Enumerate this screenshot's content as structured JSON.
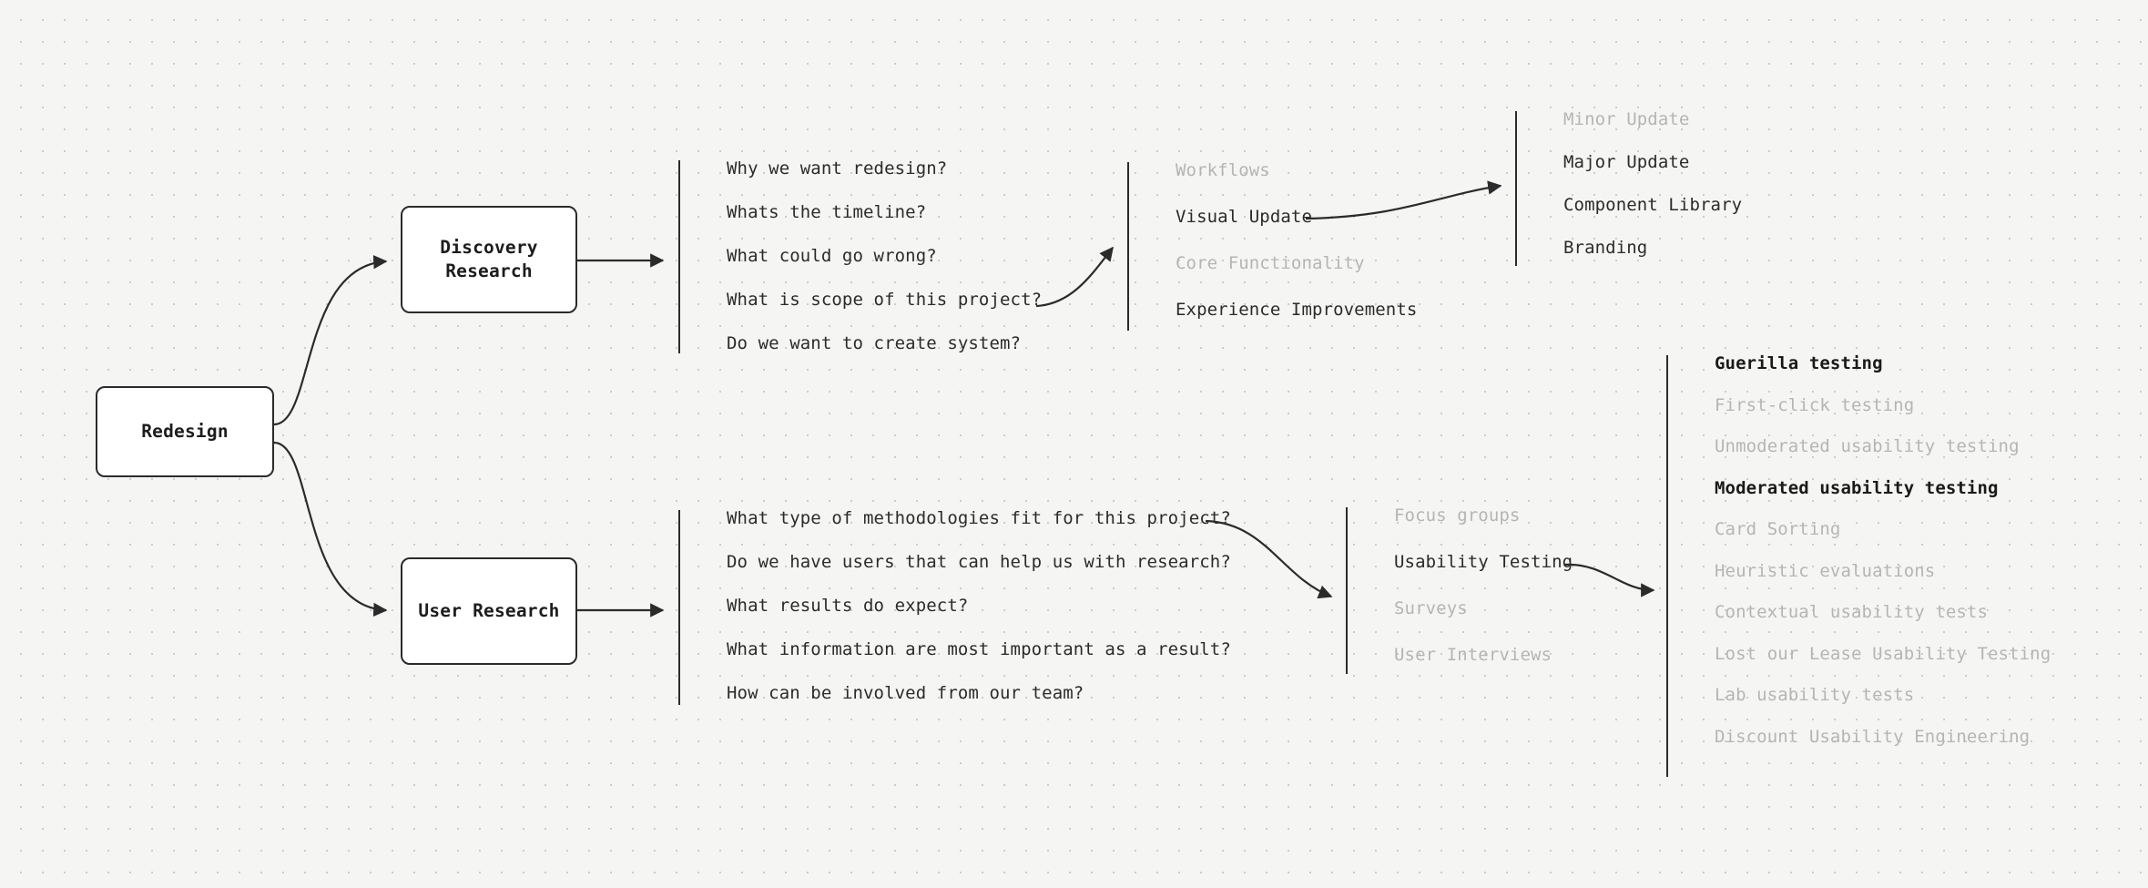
{
  "diagram": {
    "title": "Redesign research map",
    "background_color": "#f5f5f4",
    "grid_dot_color": "#cccccc",
    "line_color": "#2b2b2b",
    "muted_text_color": "#b5b5b5"
  },
  "nodes": {
    "root": {
      "label": "Redesign"
    },
    "discovery": {
      "label": "Discovery\nResearch"
    },
    "user": {
      "label": "User Research"
    }
  },
  "columns": {
    "discovery_questions": {
      "name": "discovery-questions",
      "items": [
        {
          "label": "Why we want redesign?",
          "state": "active"
        },
        {
          "label": "Whats the timeline?",
          "state": "active"
        },
        {
          "label": "What could go wrong?",
          "state": "active"
        },
        {
          "label": "What is scope of this project?",
          "state": "active"
        },
        {
          "label": "Do we want to create system?",
          "state": "active"
        }
      ]
    },
    "update_types": {
      "name": "update-types",
      "items": [
        {
          "label": "Workflows",
          "state": "muted"
        },
        {
          "label": "Visual Update",
          "state": "active"
        },
        {
          "label": "Core Functionality",
          "state": "muted"
        },
        {
          "label": "Experience Improvements",
          "state": "active"
        }
      ]
    },
    "update_scope": {
      "name": "update-scope",
      "items": [
        {
          "label": "Minor Update",
          "state": "muted"
        },
        {
          "label": "Major Update",
          "state": "active"
        },
        {
          "label": "Component Library",
          "state": "active"
        },
        {
          "label": "Branding",
          "state": "active"
        }
      ]
    },
    "research_questions": {
      "name": "research-questions",
      "items": [
        {
          "label": "What type of methodologies fit for this project?",
          "state": "active"
        },
        {
          "label": "Do we have users that can help us with research?",
          "state": "active"
        },
        {
          "label": "What results do expect?",
          "state": "active"
        },
        {
          "label": "What information are most important as a result?",
          "state": "active"
        },
        {
          "label": "How can be involved from our team?",
          "state": "active"
        }
      ]
    },
    "methodologies": {
      "name": "methodologies",
      "items": [
        {
          "label": "Focus groups",
          "state": "muted"
        },
        {
          "label": "Usability Testing",
          "state": "active"
        },
        {
          "label": "Surveys",
          "state": "muted"
        },
        {
          "label": "User Interviews",
          "state": "muted"
        }
      ]
    },
    "testing_methods": {
      "name": "testing-methods",
      "items": [
        {
          "label": "Guerilla testing",
          "state": "strong"
        },
        {
          "label": "First-click testing",
          "state": "muted"
        },
        {
          "label": "Unmoderated usability testing",
          "state": "muted"
        },
        {
          "label": "Moderated usability testing",
          "state": "strong"
        },
        {
          "label": "Card Sorting",
          "state": "muted"
        },
        {
          "label": "Heuristic evaluations",
          "state": "muted"
        },
        {
          "label": "Contextual usability tests",
          "state": "muted"
        },
        {
          "label": "Lost our Lease Usability Testing",
          "state": "muted"
        },
        {
          "label": "Lab usability tests",
          "state": "muted"
        },
        {
          "label": "Discount Usability Engineering",
          "state": "muted"
        }
      ]
    }
  }
}
